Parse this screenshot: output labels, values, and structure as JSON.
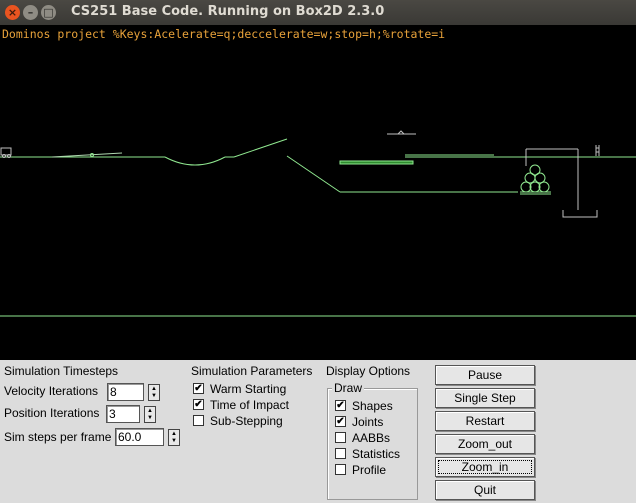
{
  "window": {
    "title": "CS251 Base Code. Running on Box2D 2.3.0",
    "close_glyph": "×",
    "minimize_glyph": "–",
    "maximize_glyph": "□"
  },
  "canvas": {
    "hud_text": "Dominos project %Keys:Acelerate=q;deccelerate=w;stop=h;%rotate=i",
    "background_color": "#000000",
    "shape_color": "#90e890",
    "static_color": "#c0c0c0"
  },
  "panel": {
    "timesteps_title": "Simulation Timesteps",
    "velocity_label": "Velocity Iterations",
    "velocity_value": "8",
    "position_label": "Position Iterations",
    "position_value": "3",
    "simsteps_label": "Sim steps per frame",
    "simsteps_value": "60.0",
    "params_title": "Simulation Parameters",
    "params": [
      {
        "label": "Warm Starting",
        "checked": true
      },
      {
        "label": "Time of Impact",
        "checked": true
      },
      {
        "label": "Sub-Stepping",
        "checked": false
      }
    ],
    "display_title": "Display Options",
    "draw_title": "Draw",
    "draw_options": [
      {
        "label": "Shapes",
        "checked": true
      },
      {
        "label": "Joints",
        "checked": true
      },
      {
        "label": "AABBs",
        "checked": false
      },
      {
        "label": "Statistics",
        "checked": false
      },
      {
        "label": "Profile",
        "checked": false
      }
    ],
    "buttons": [
      "Pause",
      "Single Step",
      "Restart",
      "Zoom_out",
      "Zoom_in",
      "Quit"
    ],
    "check_glyph": "✔",
    "spin_up": "▲",
    "spin_down": "▼"
  }
}
